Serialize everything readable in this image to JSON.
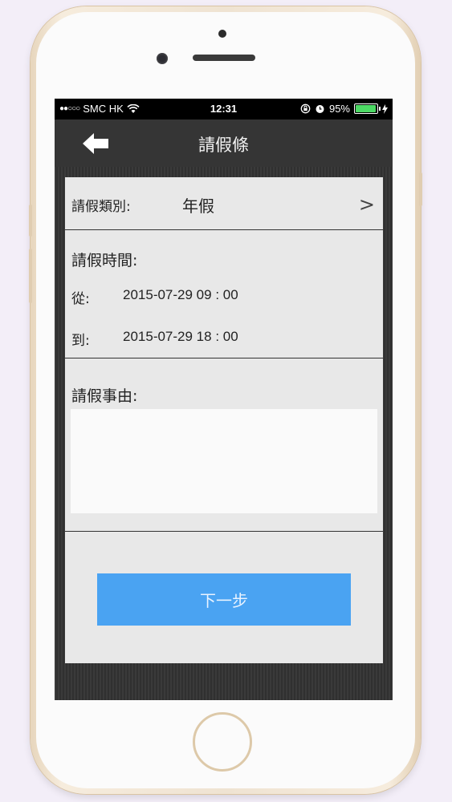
{
  "status_bar": {
    "signal": "●●○○○",
    "carrier": "SMC HK",
    "time": "12:31",
    "battery_percent": "95%",
    "battery_level": 0.95
  },
  "nav": {
    "title": "請假條",
    "back_icon": "arrow-left-icon"
  },
  "form": {
    "type_label": "請假類別:",
    "type_value": "年假",
    "type_chevron": ">",
    "time_heading": "請假時間:",
    "from_label": "從:",
    "from_value": "2015-07-29 09 : 00",
    "to_label": "到:",
    "to_value": "2015-07-29 18 : 00",
    "reason_heading": "請假事由:",
    "reason_value": "",
    "next_label": "下一步"
  },
  "colors": {
    "accent": "#4aa3f2",
    "nav_bg": "#353535",
    "card_bg": "#e8e8e8",
    "battery": "#4cd964"
  }
}
